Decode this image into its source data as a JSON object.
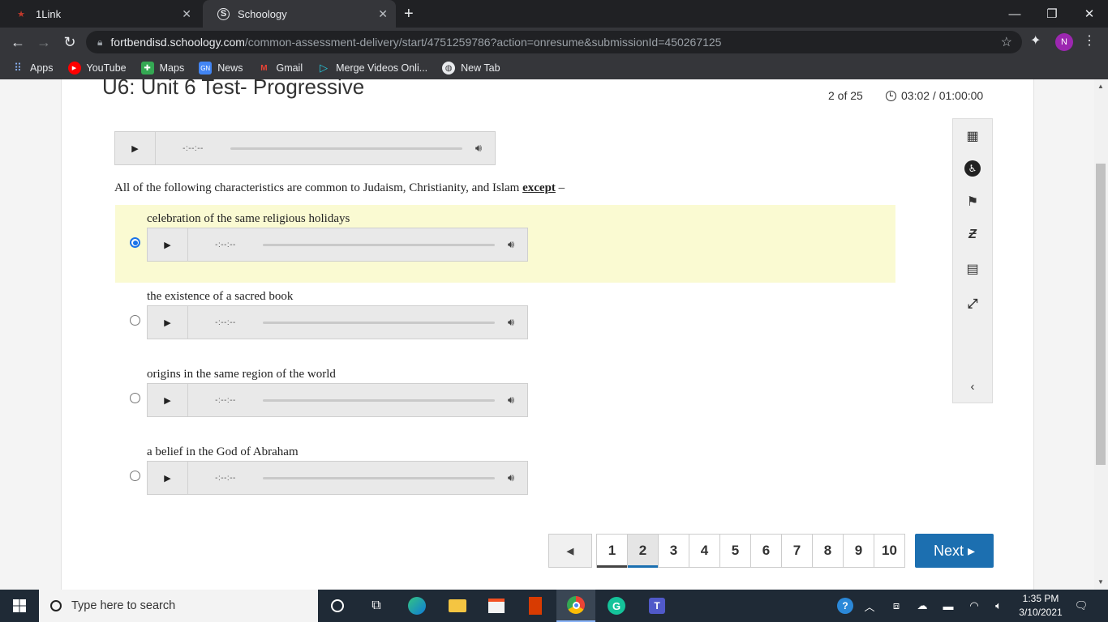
{
  "browser": {
    "tabs": [
      {
        "title": "1Link",
        "active": false
      },
      {
        "title": "Schoology",
        "active": true
      }
    ],
    "new_tab_label": "+",
    "url_host": "fortbendisd.schoology.com",
    "url_path": "/common-assessment-delivery/start/4751259786?action=onresume&submissionId=450267125",
    "profile_initial": "N",
    "bookmarks": [
      {
        "label": "Apps",
        "icon": "apps-grid-icon"
      },
      {
        "label": "YouTube",
        "icon": "youtube-icon"
      },
      {
        "label": "Maps",
        "icon": "maps-icon"
      },
      {
        "label": "News",
        "icon": "news-icon"
      },
      {
        "label": "Gmail",
        "icon": "gmail-icon"
      },
      {
        "label": "Merge Videos Onli...",
        "icon": "play-triangle-icon"
      },
      {
        "label": "New Tab",
        "icon": "globe-icon"
      }
    ]
  },
  "assessment": {
    "title": "U6: Unit 6 Test- Progressive",
    "progress": "2 of 25",
    "timer": "03:02 / 01:00:00",
    "audio_time": "-:--:--",
    "question_text": "All of the following characteristics are common to Judaism, Christianity, and Islam ",
    "question_emphasis": "except",
    "question_tail": " –",
    "choices": [
      {
        "label": "celebration of the same religious holidays",
        "selected": true
      },
      {
        "label": "the existence of a sacred book",
        "selected": false
      },
      {
        "label": "origins in the same region of the world",
        "selected": false
      },
      {
        "label": "a belief in the God of Abraham",
        "selected": false
      }
    ],
    "tools": [
      "calculator-icon",
      "accessibility-icon",
      "flag-icon",
      "eliminate-answer-icon",
      "notepad-icon",
      "fullscreen-icon",
      "collapse-chevron-icon"
    ],
    "pager": {
      "prev_label": "◀",
      "pages": [
        "1",
        "2",
        "3",
        "4",
        "5",
        "6",
        "7",
        "8",
        "9",
        "10"
      ],
      "current": "2",
      "next_label": "Next ▸"
    }
  },
  "taskbar": {
    "search_placeholder": "Type here to search",
    "time": "1:35 PM",
    "date": "3/10/2021"
  },
  "colors": {
    "selected_choice_bg": "#fafad2",
    "next_button": "#1c6fb0",
    "chrome_dark": "#202124"
  }
}
